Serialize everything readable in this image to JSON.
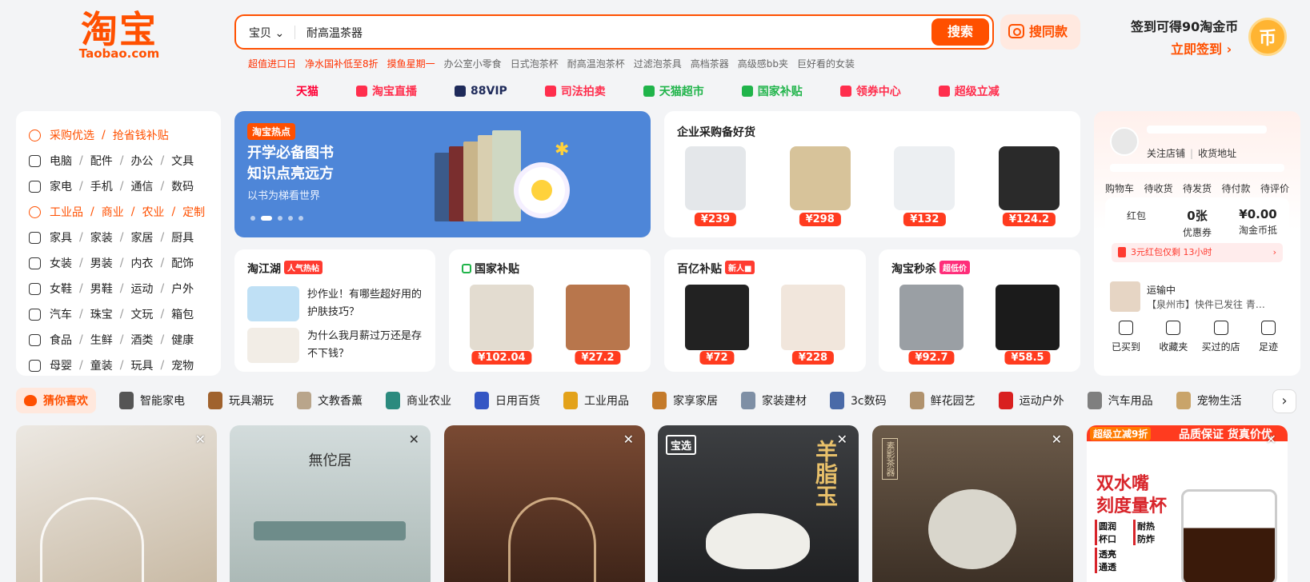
{
  "logo": {
    "cn": "淘宝",
    "en": "Taobao.com"
  },
  "search": {
    "category": "宝贝 ⌄",
    "query": "耐高温茶器",
    "button": "搜索",
    "same_style": "搜同款"
  },
  "hot_searches": [
    {
      "text": "超值进口日",
      "red": true
    },
    {
      "text": "净水国补低至8折",
      "red": true
    },
    {
      "text": "摸鱼星期一",
      "red": true
    },
    {
      "text": "办公室小零食",
      "red": false
    },
    {
      "text": "日式泡茶杯",
      "red": false
    },
    {
      "text": "耐高温泡茶杯",
      "red": false
    },
    {
      "text": "过滤泡茶具",
      "red": false
    },
    {
      "text": "高档茶器",
      "red": false
    },
    {
      "text": "高级感bb夹",
      "red": false
    },
    {
      "text": "巨好看的女装",
      "red": false
    }
  ],
  "signin": {
    "line1": "签到可得90淘金币",
    "line2": "立即签到 ›",
    "coin": "币"
  },
  "quick_links": [
    {
      "label": "天猫",
      "color": "#ff0036",
      "icon": "tmall-icon"
    },
    {
      "label": "淘宝直播",
      "color": "#ff2e4d",
      "icon": "live-icon"
    },
    {
      "label": "88VIP",
      "color": "#1e2a5a",
      "icon": "vip-icon"
    },
    {
      "label": "司法拍卖",
      "color": "#ff2e4d",
      "icon": "auction-icon"
    },
    {
      "label": "天猫超市",
      "color": "#20b44a",
      "icon": "supermarket-icon"
    },
    {
      "label": "国家补贴",
      "color": "#20b44a",
      "icon": "subsidy-icon"
    },
    {
      "label": "领券中心",
      "color": "#ff2e4d",
      "icon": "coupon-icon"
    },
    {
      "label": "超级立减",
      "color": "#ff2e4d",
      "icon": "arrow-down-icon"
    }
  ],
  "categories": [
    {
      "items": [
        "采购优选",
        "抢省钱补贴"
      ],
      "active": true,
      "icon": "flame-icon"
    },
    {
      "items": [
        "电脑",
        "配件",
        "办公",
        "文具"
      ],
      "icon": "monitor-icon"
    },
    {
      "items": [
        "家电",
        "手机",
        "通信",
        "数码"
      ],
      "icon": "phone-icon"
    },
    {
      "items": [
        "工业品",
        "商业",
        "农业",
        "定制"
      ],
      "active": true,
      "icon": "target-icon"
    },
    {
      "items": [
        "家具",
        "家装",
        "家居",
        "厨具"
      ],
      "icon": "sofa-icon"
    },
    {
      "items": [
        "女装",
        "男装",
        "内衣",
        "配饰"
      ],
      "icon": "shirt-icon"
    },
    {
      "items": [
        "女鞋",
        "男鞋",
        "运动",
        "户外"
      ],
      "icon": "shoe-icon"
    },
    {
      "items": [
        "汽车",
        "珠宝",
        "文玩",
        "箱包"
      ],
      "icon": "car-icon"
    },
    {
      "items": [
        "食品",
        "生鲜",
        "酒类",
        "健康"
      ],
      "icon": "food-icon"
    },
    {
      "items": [
        "母婴",
        "童装",
        "玩具",
        "宠物"
      ],
      "icon": "bottle-icon"
    }
  ],
  "banner": {
    "tag": "淘宝热点",
    "line1": "开学必备图书",
    "line2": "知识点亮远方",
    "sub": "以书为梯看世界",
    "dots": 5,
    "active_dot": 1
  },
  "b2b": {
    "title": "企业采购备好货",
    "products": [
      {
        "price": "¥239",
        "color": "#e4e7ea"
      },
      {
        "price": "¥298",
        "color": "#d7c39a"
      },
      {
        "price": "¥132",
        "color": "#eceff2"
      },
      {
        "price": "¥124.2",
        "color": "#2a2a2a"
      }
    ]
  },
  "account": {
    "follow_shop": "关注店铺",
    "address": "收货地址",
    "orders": [
      "购物车",
      "待收货",
      "待发货",
      "待付款",
      "待评价"
    ],
    "wallet": [
      {
        "n": "",
        "l": "红包"
      },
      {
        "n": "0张",
        "l": "优惠券"
      },
      {
        "n": "¥0.00",
        "l": "淘金币抵"
      }
    ],
    "red_packet": "3元红包仅剩 13小时",
    "shipping": {
      "title": "运输中",
      "detail": "【泉州市】快件已发往 青…"
    },
    "shortcuts": [
      {
        "label": "已买到",
        "icon": "clipboard-icon"
      },
      {
        "label": "收藏夹",
        "icon": "star-icon"
      },
      {
        "label": "买过的店",
        "icon": "bag-icon"
      },
      {
        "label": "足迹",
        "icon": "clock-icon"
      }
    ]
  },
  "lake": {
    "title": "淘江湖",
    "tag": "人气热帖",
    "posts": [
      {
        "text": "抄作业！有哪些超好用的护肤技巧？",
        "color": "#bfe0f5"
      },
      {
        "text": "为什么我月薪过万还是存不下钱？",
        "color": "#f2ede6"
      }
    ]
  },
  "subsidy": {
    "title": "国家补贴",
    "products": [
      {
        "price": "¥102.04",
        "color": "#e3dcd0"
      },
      {
        "price": "¥27.2",
        "color": "#b8764c"
      }
    ]
  },
  "billion": {
    "title": "百亿补贴",
    "tag": "新人■",
    "products": [
      {
        "price": "¥72",
        "color": "#222222"
      },
      {
        "price": "¥228",
        "color": "#f1e6dc"
      }
    ]
  },
  "flash": {
    "title": "淘宝秒杀",
    "tag": "超低价",
    "products": [
      {
        "price": "¥92.7",
        "color": "#9a9fa4"
      },
      {
        "price": "¥58.5",
        "color": "#1b1b1b"
      }
    ]
  },
  "feed_tabs": [
    {
      "label": "猜你喜欢",
      "color": "#ff5000",
      "icon": "heart-icon"
    },
    {
      "label": "智能家电",
      "color": "#555555",
      "icon": "appliance-icon"
    },
    {
      "label": "玩具潮玩",
      "color": "#a0622d",
      "icon": "teddy-bear-icon"
    },
    {
      "label": "文教香薰",
      "color": "#b9a58b",
      "icon": "diffuser-icon"
    },
    {
      "label": "商业农业",
      "color": "#2b8a7e",
      "icon": "globe-icon"
    },
    {
      "label": "日用百货",
      "color": "#3456c4",
      "icon": "detergent-icon"
    },
    {
      "label": "工业用品",
      "color": "#e3a21a",
      "icon": "drill-icon"
    },
    {
      "label": "家享家居",
      "color": "#c47a2a",
      "icon": "furniture-icon"
    },
    {
      "label": "家装建材",
      "color": "#7e8fa5",
      "icon": "door-icon"
    },
    {
      "label": "3c数码",
      "color": "#4a6aa8",
      "icon": "laptop-icon"
    },
    {
      "label": "鲜花园艺",
      "color": "#b0926d",
      "icon": "plant-icon"
    },
    {
      "label": "运动户外",
      "color": "#d92020",
      "icon": "racket-icon"
    },
    {
      "label": "汽车用品",
      "color": "#7f7f7f",
      "icon": "car-spray-icon"
    },
    {
      "label": "宠物生活",
      "color": "#c9a46a",
      "icon": "pet-food-icon"
    }
  ],
  "feed": {
    "f2_brand": "無佗居",
    "f4_badge": "宝选",
    "f4_title": "羊脂玉",
    "f5_brand": "素影茶器",
    "f6": {
      "badge": "超级立减9折",
      "banner": "品质保证 货真价优",
      "title1": "双水嘴",
      "title2": "刻度量杯",
      "features": [
        "圆润杯口",
        "耐热防炸",
        "透亮通透"
      ]
    }
  }
}
